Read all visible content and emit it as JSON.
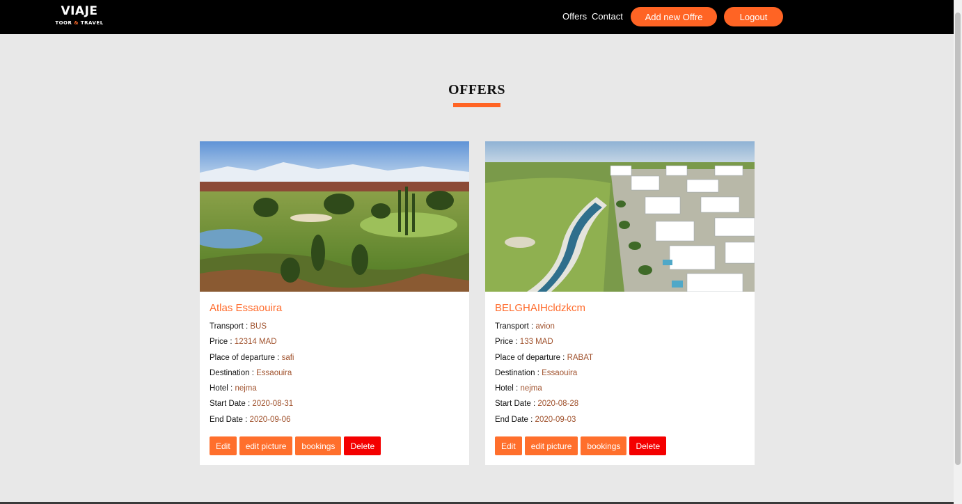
{
  "brand": {
    "name": "VIAJE",
    "tagline_part1": "TOOR",
    "tagline_amp": "&",
    "tagline_part2": "TRAVEL"
  },
  "nav": {
    "offers_label": "Offers",
    "contact_label": "Contact",
    "add_offer_label": "Add new Offre",
    "logout_label": "Logout"
  },
  "page": {
    "title": "OFFERS"
  },
  "colors": {
    "accent": "#ff6424",
    "danger": "#f40000",
    "value_text": "#a0522d",
    "background": "#e8e8e8",
    "navbar": "#000000"
  },
  "labels": {
    "transport": "Transport :",
    "price": "Price :",
    "departure": "Place of departure :",
    "destination": "Destination :",
    "hotel": "Hotel :",
    "start_date": "Start Date :",
    "end_date": "End Date :"
  },
  "buttons": {
    "edit": "Edit",
    "edit_picture": "edit picture",
    "bookings": "bookings",
    "delete": "Delete"
  },
  "offers": [
    {
      "title": "Atlas Essaouira",
      "transport": "BUS",
      "price": "12314 MAD",
      "departure": "safi",
      "destination": "Essaouira",
      "hotel": "nejma",
      "start_date": "2020-08-31",
      "end_date": "2020-09-06",
      "image": "golf-course-landscape"
    },
    {
      "title": "BELGHAIHcldzkcm",
      "transport": "avion",
      "price": "133 MAD",
      "departure": "RABAT",
      "destination": "Essaouira",
      "hotel": "nejma",
      "start_date": "2020-08-28",
      "end_date": "2020-09-03",
      "image": "resort-lake-aerial"
    }
  ]
}
